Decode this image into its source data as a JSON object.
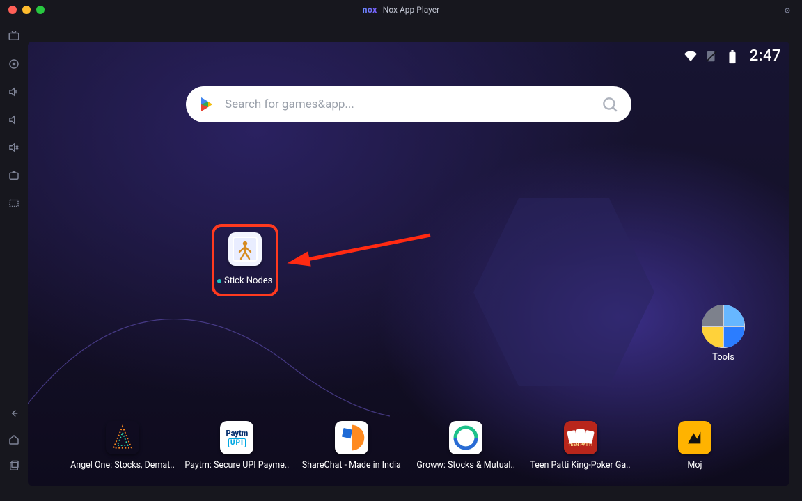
{
  "title": {
    "brand": "nox",
    "name": "Nox App Player"
  },
  "status": {
    "time": "2:47"
  },
  "search": {
    "placeholder": "Search for games&app..."
  },
  "highlight": {
    "label": "Stick Nodes"
  },
  "tools": {
    "label": "Tools"
  },
  "dock": [
    {
      "label": "Angel One: Stocks, Demat.."
    },
    {
      "label": "Paytm: Secure UPI Payme.."
    },
    {
      "label": "ShareChat - Made in India"
    },
    {
      "label": "Groww: Stocks & Mutual.."
    },
    {
      "label": "Teen Patti King-Poker Ga.."
    },
    {
      "label": "Moj"
    }
  ],
  "paytm": {
    "line1": "Paytm",
    "line2": "UPI"
  },
  "teen": {
    "line": "TEEN PATTI"
  }
}
